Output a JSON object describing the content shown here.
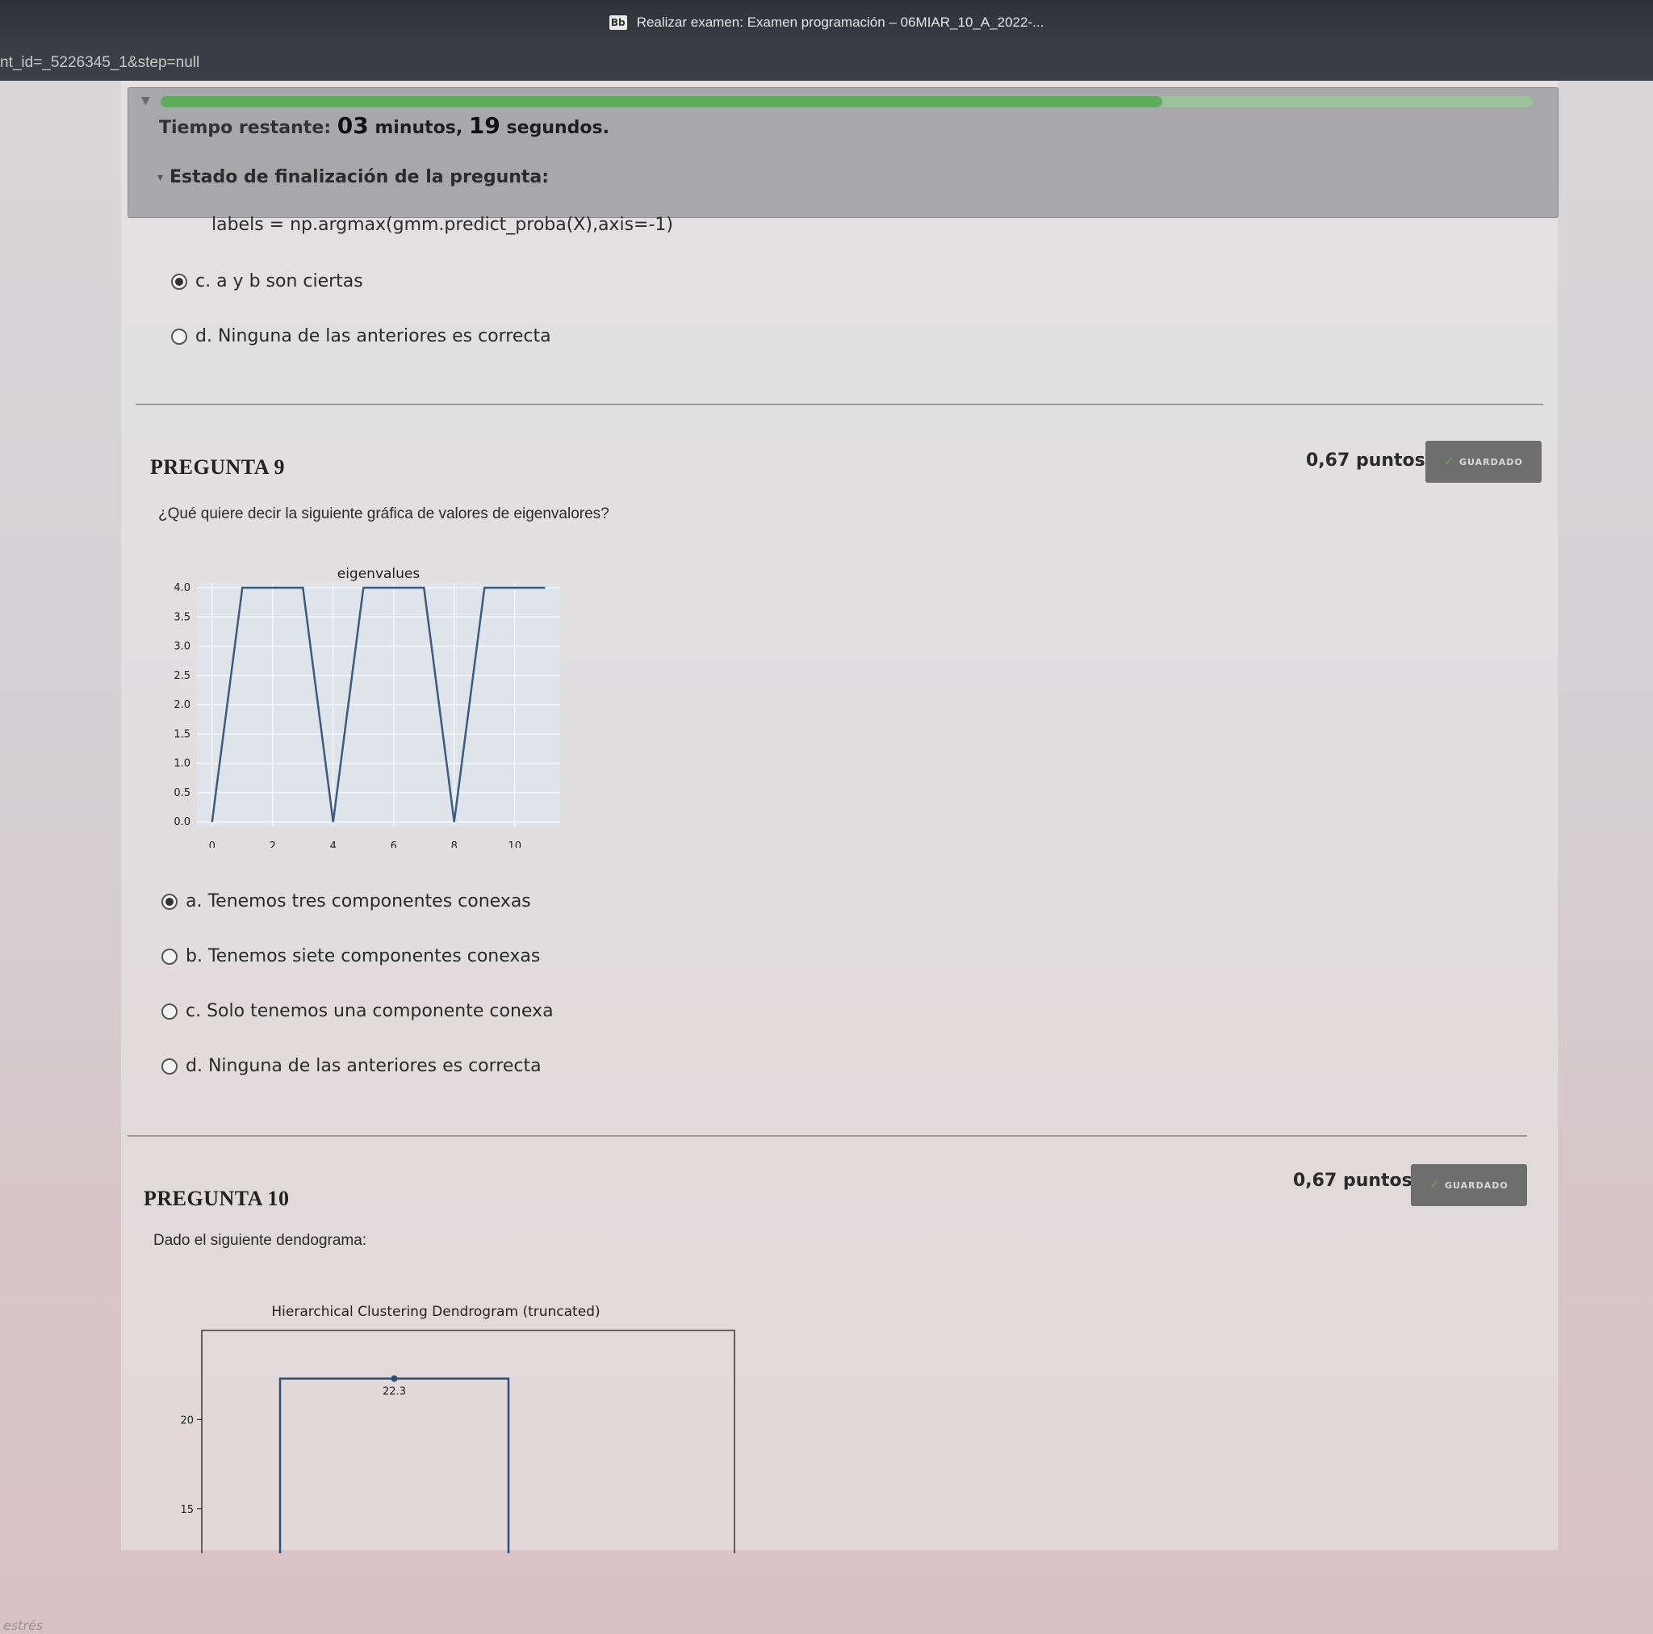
{
  "browser": {
    "icon_label": "Bb",
    "window_title": "Realizar examen: Examen programación – 06MIAR_10_A_2022-...",
    "url_fragment": "nt_id=_5226345_1&step=null"
  },
  "status": {
    "progress_fraction": 0.73,
    "timer_label": "Tiempo restante:",
    "minutes": "03",
    "minutes_unit": "minutos,",
    "seconds": "19",
    "seconds_unit": "segundos.",
    "completion_label": "Estado de finalización de la pregunta:"
  },
  "previous_question": {
    "code_line": "labels = np.argmax(gmm.predict_proba(X),axis=-1)",
    "options": [
      {
        "label": "c. a y b son ciertas",
        "checked": true
      },
      {
        "label": "d. Ninguna de las anteriores es correcta",
        "checked": false
      }
    ]
  },
  "question9": {
    "title": "PREGUNTA 9",
    "points": "0,67 puntos",
    "saved_label": "GUARDADO",
    "text": "¿Qué quiere decir la siguiente gráfica de valores de eigenvalores?",
    "options": [
      {
        "label": "a. Tenemos tres componentes conexas",
        "checked": true
      },
      {
        "label": "b. Tenemos siete componentes conexas",
        "checked": false
      },
      {
        "label": "c. Solo tenemos una componente conexa",
        "checked": false
      },
      {
        "label": "d. Ninguna de las anteriores es correcta",
        "checked": false
      }
    ]
  },
  "question10": {
    "title": "PREGUNTA 10",
    "points": "0,67 puntos",
    "saved_label": "GUARDADO",
    "text": "Dado el siguiente dendograma:"
  },
  "chart_data": [
    {
      "type": "line",
      "title": "eigenvalues",
      "x": [
        0,
        1,
        2,
        3,
        4,
        5,
        6,
        7,
        8,
        9,
        10,
        11
      ],
      "values": [
        0.0,
        4.0,
        4.0,
        4.0,
        0.0,
        4.0,
        4.0,
        4.0,
        0.0,
        4.0,
        4.0,
        4.0
      ],
      "xticks": [
        "0",
        "2",
        "4",
        "6",
        "8",
        "10"
      ],
      "yticks": [
        "0.0",
        "0.5",
        "1.0",
        "1.5",
        "2.0",
        "2.5",
        "3.0",
        "3.5",
        "4.0"
      ],
      "xlim": [
        -0.5,
        11.5
      ],
      "ylim": [
        0,
        4.0
      ],
      "grid": true,
      "line_color": "#3b5b80"
    },
    {
      "type": "dendrogram",
      "title": "Hierarchical Clustering Dendrogram (truncated)",
      "merge_height": 22.3,
      "merge_label": "22.3",
      "yticks": [
        "15",
        "20"
      ],
      "ylim": [
        12.5,
        25
      ],
      "line_color": "#2a4f76"
    }
  ],
  "footer": {
    "partial_text": "estrés"
  }
}
